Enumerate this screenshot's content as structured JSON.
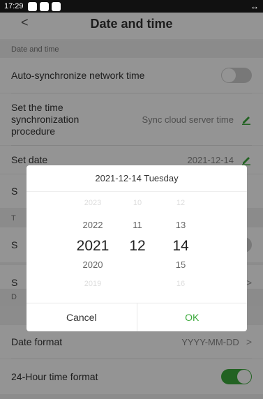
{
  "status": {
    "time": "17:29",
    "right_glyph": "↔"
  },
  "header": {
    "title": "Date and time",
    "back_label": "<"
  },
  "sections": {
    "date_time": "Date and time",
    "t_partial": "T",
    "d_partial": "D"
  },
  "rows": {
    "auto_sync": {
      "label": "Auto-synchronize network time"
    },
    "sync_proc": {
      "label": "Set the time\nsynchronization\nprocedure",
      "value": "Sync cloud server time"
    },
    "set_date": {
      "label": "Set date",
      "value": "2021-12-14"
    },
    "partial_s1": "S",
    "partial_s2": "S",
    "partial_s3": "S",
    "date_format": {
      "label": "Date format",
      "value": "YYYY-MM-DD"
    },
    "hour24": {
      "label": "24-Hour time format"
    }
  },
  "colors": {
    "accent": "#3caa3c"
  },
  "dialog": {
    "header": "2021-12-14 Tuesday",
    "years": {
      "far_up": "2023",
      "near_up": "2022",
      "selected": "2021",
      "near_down": "2020",
      "far_down": "2019"
    },
    "months": {
      "far_up": "10",
      "near_up": "11",
      "selected": "12"
    },
    "days": {
      "far_up": "12",
      "near_up": "13",
      "selected": "14",
      "near_down": "15",
      "far_down": "16"
    },
    "cancel_label": "Cancel",
    "ok_label": "OK"
  }
}
